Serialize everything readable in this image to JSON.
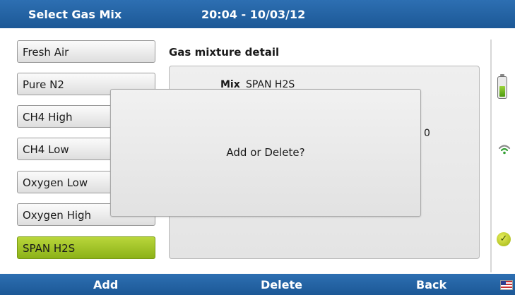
{
  "header": {
    "title": "Select Gas Mix",
    "datetime": "20:04 - 10/03/12"
  },
  "gas_list": {
    "items": [
      "Fresh Air",
      "Pure N2",
      "CH4 High",
      "CH4 Low",
      "Oxygen Low",
      "Oxygen High",
      "SPAN H2S"
    ],
    "selected": "SPAN H2S"
  },
  "detail": {
    "title": "Gas mixture detail",
    "mix_label": "Mix",
    "mix_value": "SPAN H2S",
    "partial_value": "0"
  },
  "dialog": {
    "message": "Add or Delete?"
  },
  "status": {
    "battery_level": 0.55,
    "signal_icon": "wifi-icon",
    "status_icon": "check-icon"
  },
  "footer": {
    "add": "Add",
    "delete": "Delete",
    "back": "Back",
    "language_icon": "us-flag-icon"
  },
  "colors": {
    "bar_blue": "#1c5896",
    "selected_green": "#9cc02a"
  }
}
